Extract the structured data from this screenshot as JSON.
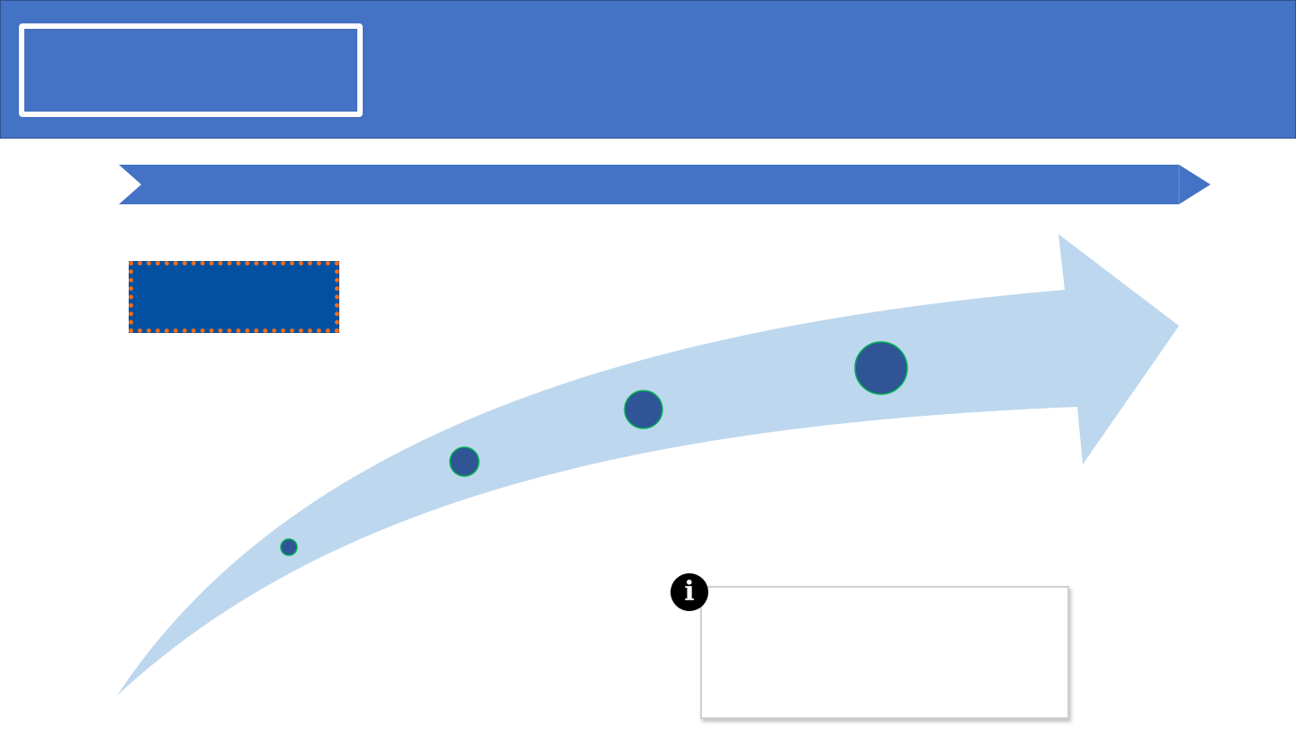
{
  "header": {
    "title": ""
  },
  "timeline": {
    "label": ""
  },
  "note": {
    "text": ""
  },
  "icons": {
    "info": "info-icon"
  },
  "colors": {
    "header_fill": "#4472c4",
    "timeline_bar": "#4472c4",
    "curved_arrow": "#bdd7ee",
    "milestone_fill": "#2f5597",
    "milestone_stroke": "#00b050",
    "label_fill": "#0450a0",
    "label_border": "#ed6c1c"
  }
}
